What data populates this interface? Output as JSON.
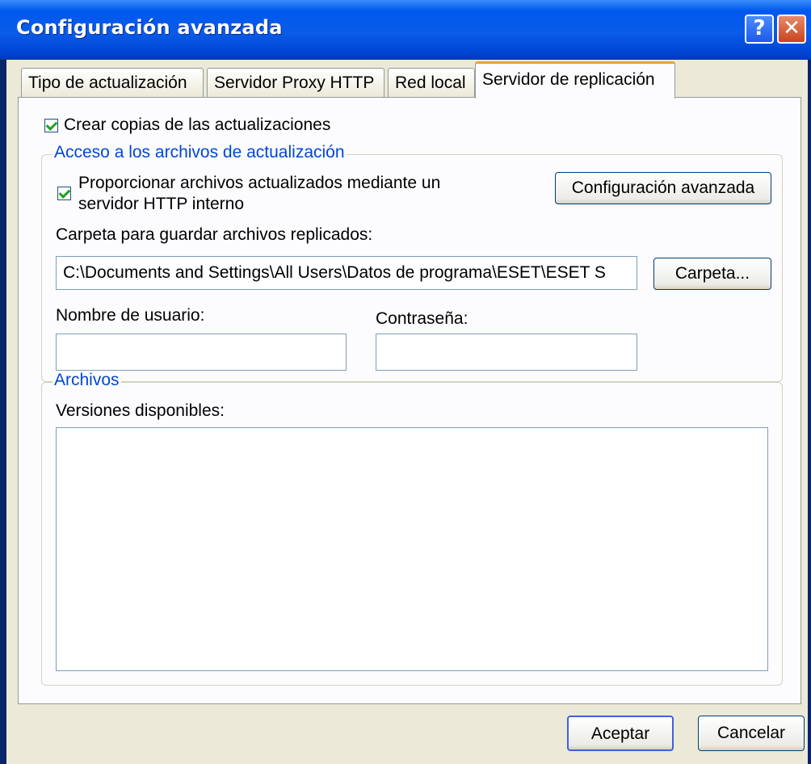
{
  "window": {
    "title": "Configuración avanzada"
  },
  "tabs": [
    {
      "label": "Tipo de actualización"
    },
    {
      "label": "Servidor Proxy HTTP"
    },
    {
      "label": "Red local"
    },
    {
      "label": "Servidor de replicación"
    }
  ],
  "main": {
    "create_copies": {
      "label": "Crear copias de las actualizaciones",
      "checked": true
    },
    "access_group": {
      "legend": "Acceso a los archivos de actualización",
      "provide_http": {
        "line1": "Proporcionar archivos actualizados mediante un",
        "line2": "servidor HTTP interno",
        "checked": true
      },
      "advanced_button": "Configuración avanzada",
      "folder_label": "Carpeta para guardar archivos replicados:",
      "folder_value": "C:\\Documents and Settings\\All Users\\Datos de programa\\ESET\\ESET S",
      "folder_button": "Carpeta...",
      "username_label": "Nombre de usuario:",
      "username_value": "",
      "password_label": "Contraseña:",
      "password_value": ""
    },
    "files_group": {
      "legend": "Archivos",
      "versions_label": "Versiones disponibles:",
      "versions": []
    }
  },
  "footer": {
    "ok_button": "Aceptar",
    "cancel_button": "Cancelar"
  },
  "colors": {
    "title_bar": "#0058ee",
    "legend_text": "#0046d5",
    "dialog_bg": "#ece9d8",
    "check": "#21a121"
  }
}
